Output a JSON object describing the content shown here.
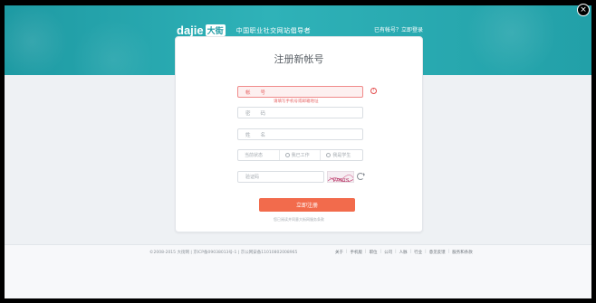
{
  "header": {
    "logo_text": "dajie",
    "logo_cn": "大街",
    "tagline": "中国职业社交网站倡导者",
    "login_link": "已有帐号？立即登录"
  },
  "form": {
    "title": "注册新帐号",
    "account_placeholder": "帐　　号",
    "account_error": "请填写手机号或邮箱地址",
    "password_placeholder": "密　　码",
    "name_placeholder": "姓　　名",
    "status_label": "当前状态",
    "status_options": [
      "我已工作",
      "我是学生"
    ],
    "captcha_placeholder": "验证码",
    "captcha_text": "vmas",
    "submit_label": "立即注册",
    "agreement_text": "您已阅读并同意大街网服务条款"
  },
  "footer": {
    "copyright": "©2008-2015 大街网 | 京ICP备09038013号-1 | 京公网安备11010802008965",
    "links": [
      "关于",
      "手机版",
      "职位",
      "公司",
      "人脉",
      "行业",
      "意见反馈",
      "服务和条款"
    ]
  },
  "colors": {
    "brand_teal": "#2fb2b8",
    "submit_orange": "#f26b4c",
    "error_red": "#e34c4c"
  },
  "icons": {
    "close": "close-icon",
    "error": "error-icon",
    "refresh": "refresh-icon"
  }
}
